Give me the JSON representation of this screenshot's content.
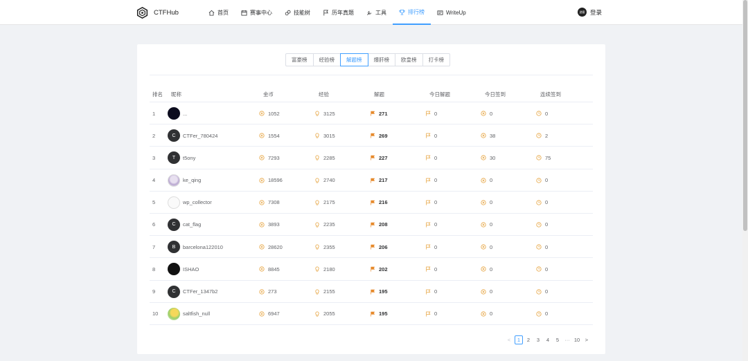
{
  "header": {
    "logo_text": "CTFHub",
    "nav": [
      {
        "label": "首页",
        "icon": "home-icon"
      },
      {
        "label": "赛事中心",
        "icon": "calendar-icon"
      },
      {
        "label": "技能树",
        "icon": "skill-tree-icon"
      },
      {
        "label": "历年真题",
        "icon": "flag-icon"
      },
      {
        "label": "工具",
        "icon": "tool-icon"
      },
      {
        "label": "排行榜",
        "icon": "trophy-icon",
        "active": true
      },
      {
        "label": "WriteUp",
        "icon": "writeup-icon"
      }
    ],
    "login_label": "登录",
    "login_avatar_text": "游客"
  },
  "tabs": [
    "富豪榜",
    "经验榜",
    "解题榜",
    "爆肝榜",
    "欧皇榜",
    "打卡榜"
  ],
  "active_tab": "解题榜",
  "table": {
    "columns": [
      "排名",
      "昵称",
      "金币",
      "经验",
      "解题",
      "今日解题",
      "今日签到",
      "连续签到"
    ],
    "rows": [
      {
        "rank": "1",
        "name": "...",
        "avatar": "",
        "coins": "1052",
        "exp": "3125",
        "solved": "271",
        "today_solved": "0",
        "today_checkin": "0",
        "streak": "0"
      },
      {
        "rank": "2",
        "name": "CTFer_780424",
        "avatar": "C",
        "coins": "1554",
        "exp": "3015",
        "solved": "269",
        "today_solved": "0",
        "today_checkin": "38",
        "streak": "2"
      },
      {
        "rank": "3",
        "name": "t5ony",
        "avatar": "T",
        "coins": "7293",
        "exp": "2285",
        "solved": "227",
        "today_solved": "0",
        "today_checkin": "30",
        "streak": "75"
      },
      {
        "rank": "4",
        "name": "ke_qing",
        "avatar": "",
        "coins": "18596",
        "exp": "2740",
        "solved": "217",
        "today_solved": "0",
        "today_checkin": "0",
        "streak": "0"
      },
      {
        "rank": "5",
        "name": "wp_collector",
        "avatar": "",
        "coins": "7308",
        "exp": "2175",
        "solved": "216",
        "today_solved": "0",
        "today_checkin": "0",
        "streak": "0"
      },
      {
        "rank": "6",
        "name": "cat_flag",
        "avatar": "C",
        "coins": "3893",
        "exp": "2235",
        "solved": "208",
        "today_solved": "0",
        "today_checkin": "0",
        "streak": "0"
      },
      {
        "rank": "7",
        "name": "barcelona122010",
        "avatar": "B",
        "coins": "28620",
        "exp": "2355",
        "solved": "206",
        "today_solved": "0",
        "today_checkin": "0",
        "streak": "0"
      },
      {
        "rank": "8",
        "name": "ISHAO",
        "avatar": "",
        "coins": "8845",
        "exp": "2180",
        "solved": "202",
        "today_solved": "0",
        "today_checkin": "0",
        "streak": "0"
      },
      {
        "rank": "9",
        "name": "CTFer_1347b2",
        "avatar": "C",
        "coins": "273",
        "exp": "2155",
        "solved": "195",
        "today_solved": "0",
        "today_checkin": "0",
        "streak": "0"
      },
      {
        "rank": "10",
        "name": "saltfish_null",
        "avatar": "",
        "coins": "6947",
        "exp": "2055",
        "solved": "195",
        "today_solved": "0",
        "today_checkin": "0",
        "streak": "0"
      }
    ]
  },
  "pagination": {
    "prev": "<",
    "pages": [
      "1",
      "2",
      "3",
      "4",
      "5"
    ],
    "ellipsis": "···",
    "last": "10",
    "next": ">",
    "current": "1"
  },
  "colors": {
    "accent": "#409eff",
    "icon_orange": "#e6a23c",
    "flag_orange": "#e6892a"
  }
}
